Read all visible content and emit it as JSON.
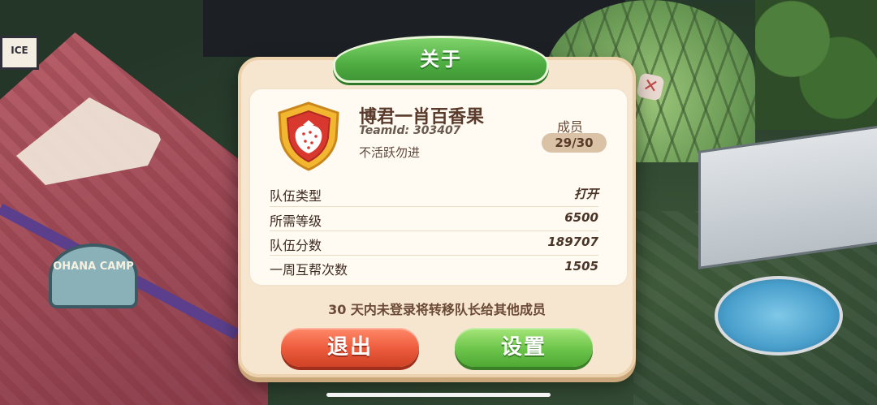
{
  "dialog": {
    "title": "关于",
    "team": {
      "name": "博君一肖百香果",
      "team_id": "TeamId: 303407",
      "description": "不活跃勿进",
      "members_label": "成员",
      "members_value": "29/30",
      "emblem_icon": "strawberry-shield-icon"
    },
    "stats": [
      {
        "label": "队伍类型",
        "value": "打开"
      },
      {
        "label": "所需等级",
        "value": "6500"
      },
      {
        "label": "队伍分数",
        "value": "189707"
      },
      {
        "label": "一周互帮次数",
        "value": "1505"
      }
    ],
    "notice": "30 天内未登录将转移队长给其他成员",
    "quit_label": "退出",
    "settings_label": "设置"
  },
  "background": {
    "camp_sign": "OHANA CAMP",
    "office_sign": "ICE"
  },
  "colors": {
    "title_green": "#4fae42",
    "quit_red": "#ec5a3b",
    "settings_green": "#6cc44a",
    "panel_cream": "#f6e6cf"
  }
}
